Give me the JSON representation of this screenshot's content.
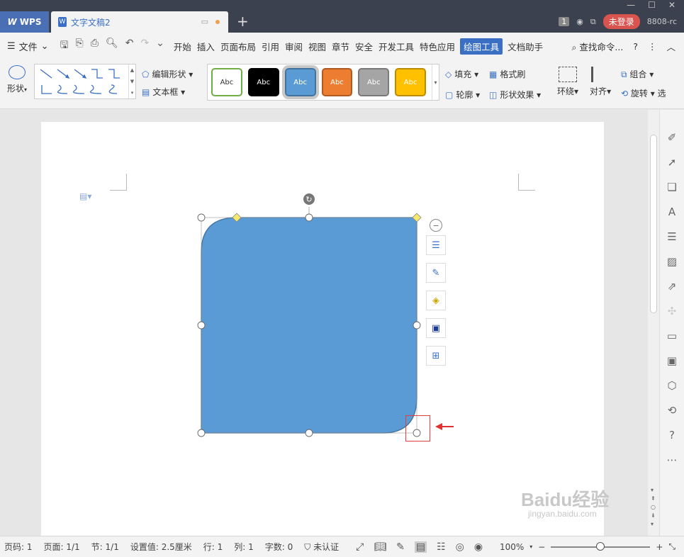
{
  "titlebar": {
    "app_name": "WPS",
    "doc_tab": "文字文稿2",
    "new_tab": "+",
    "window_count": "1",
    "login": "未登录",
    "user_id": "8808-rc"
  },
  "menubar": {
    "file": "文件",
    "items": [
      "开始",
      "插入",
      "页面布局",
      "引用",
      "审阅",
      "视图",
      "章节",
      "安全",
      "开发工具",
      "特色应用",
      "绘图工具",
      "文档助手"
    ],
    "active_item": "绘图工具",
    "search": "查找命令..."
  },
  "ribbon": {
    "shape_label": "形状",
    "edit_shape": "编辑形状",
    "text_box": "文本框",
    "styles": [
      {
        "label": "Abc",
        "bg": "#ffffff",
        "fg": "#333333",
        "border": "#70ad47"
      },
      {
        "label": "Abc",
        "bg": "#000000",
        "fg": "#ffffff",
        "border": "#000000"
      },
      {
        "label": "Abc",
        "bg": "#5b9bd5",
        "fg": "#ffffff",
        "border": "#41719c"
      },
      {
        "label": "Abc",
        "bg": "#ed7d31",
        "fg": "#ffffff",
        "border": "#ae5a21"
      },
      {
        "label": "Abc",
        "bg": "#a5a5a5",
        "fg": "#ffffff",
        "border": "#7b7b7b"
      },
      {
        "label": "Abc",
        "bg": "#ffc000",
        "fg": "#ffffff",
        "border": "#bc8c00"
      }
    ],
    "fill": "填充",
    "format_painter": "格式刷",
    "outline": "轮廓",
    "shape_effects": "形状效果",
    "wrap": "环绕",
    "align": "对齐",
    "group": "组合",
    "rotate": "旋转",
    "select": "选"
  },
  "shape": {
    "fill_color": "#5b9bd5",
    "stroke_color": "#41719c"
  },
  "statusbar": {
    "page_num": "页码: 1",
    "pages": "页面: 1/1",
    "section": "节: 1/1",
    "setting": "设置值: 2.5厘米",
    "row": "行: 1",
    "col": "列: 1",
    "word_count": "字数: 0",
    "cert": "未认证",
    "zoom": "100%",
    "zoom_level": 0.5
  },
  "watermark": {
    "text": "Baidu经验",
    "url": "jingyan.baidu.com"
  }
}
